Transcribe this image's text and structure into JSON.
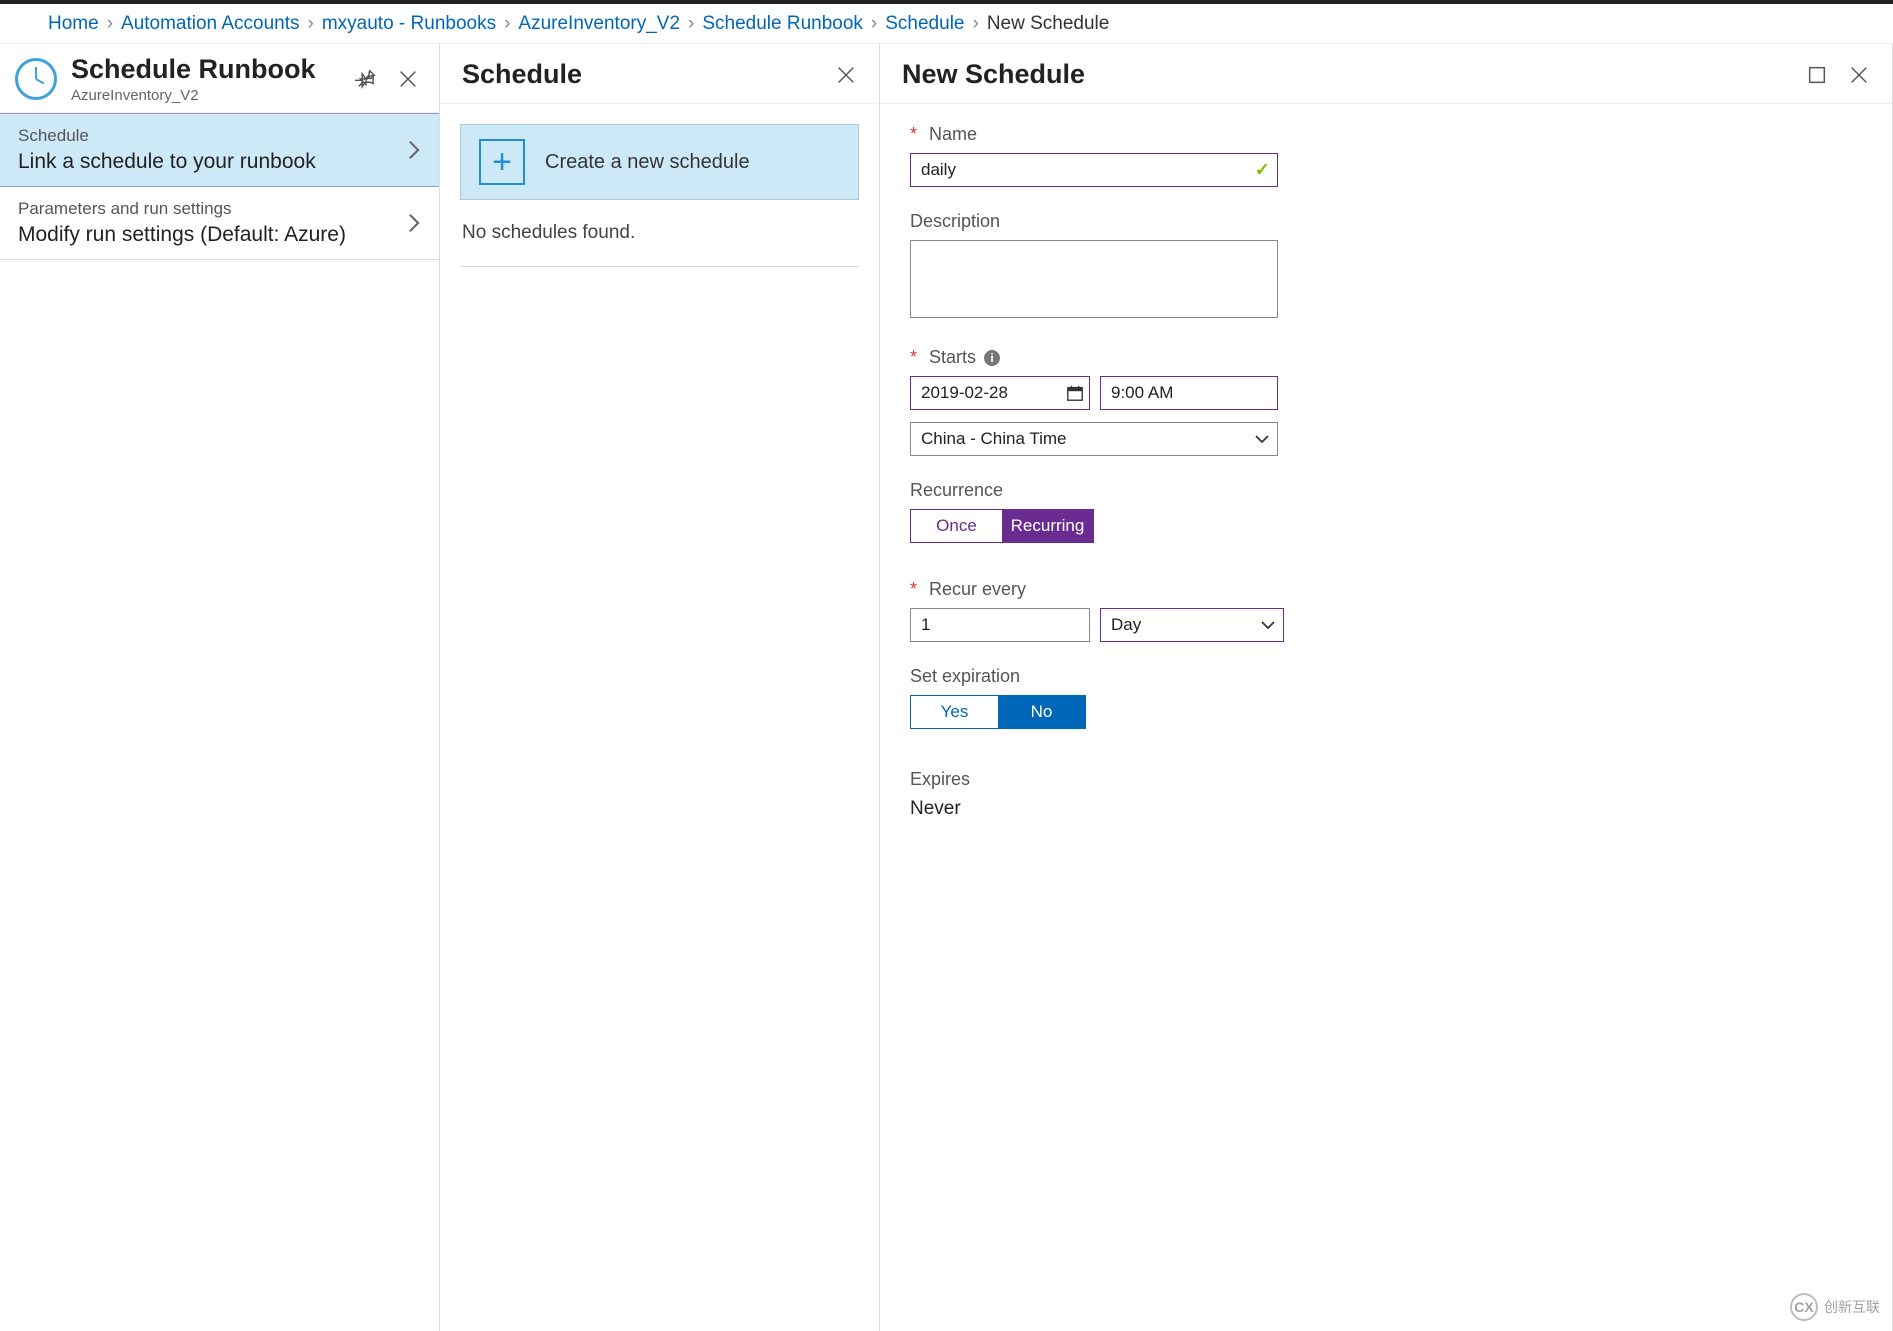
{
  "breadcrumb": {
    "items": [
      "Home",
      "Automation Accounts",
      "mxyauto - Runbooks",
      "AzureInventory_V2",
      "Schedule Runbook",
      "Schedule"
    ],
    "current": "New Schedule"
  },
  "blade1": {
    "title": "Schedule Runbook",
    "subtitle": "AzureInventory_V2",
    "items": [
      {
        "top": "Schedule",
        "bottom": "Link a schedule to your runbook",
        "selected": true
      },
      {
        "top": "Parameters and run settings",
        "bottom": "Modify run settings (Default: Azure)",
        "selected": false
      }
    ]
  },
  "blade2": {
    "title": "Schedule",
    "create_label": "Create a new schedule",
    "empty_text": "No schedules found."
  },
  "blade3": {
    "title": "New Schedule",
    "name_label": "Name",
    "name_value": "daily",
    "description_label": "Description",
    "description_value": "",
    "starts_label": "Starts",
    "start_date": "2019-02-28",
    "start_time": "9:00 AM",
    "timezone": "China - China Time",
    "recurrence_label": "Recurrence",
    "recurrence_options": [
      "Once",
      "Recurring"
    ],
    "recurrence_selected": "Recurring",
    "recur_every_label": "Recur every",
    "recur_value": "1",
    "recur_unit": "Day",
    "set_expiration_label": "Set expiration",
    "expiration_options": [
      "Yes",
      "No"
    ],
    "expiration_selected": "No",
    "expires_label": "Expires",
    "expires_value": "Never"
  },
  "watermark": "创新互联"
}
